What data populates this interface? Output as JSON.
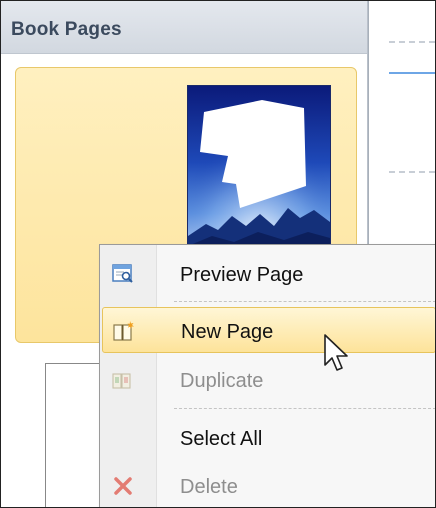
{
  "panel": {
    "title": "Book Pages"
  },
  "context_menu": {
    "items": [
      {
        "label": "Preview Page",
        "icon": "preview-page-icon",
        "enabled": true,
        "highlighted": false
      },
      {
        "label": "New Page",
        "icon": "new-page-icon",
        "enabled": true,
        "highlighted": true
      },
      {
        "label": "Duplicate",
        "icon": "duplicate-icon",
        "enabled": false,
        "highlighted": false
      },
      {
        "label": "Select All",
        "icon": "",
        "enabled": true,
        "highlighted": false
      },
      {
        "label": "Delete",
        "icon": "delete-icon",
        "enabled": false,
        "highlighted": false
      }
    ]
  },
  "colors": {
    "selection_fill": "#fde49c",
    "selection_border": "#e8c86a",
    "panel_header": "#d6dbe3",
    "accent_line": "#6ea6e6",
    "delete_red": "#e0564a"
  }
}
